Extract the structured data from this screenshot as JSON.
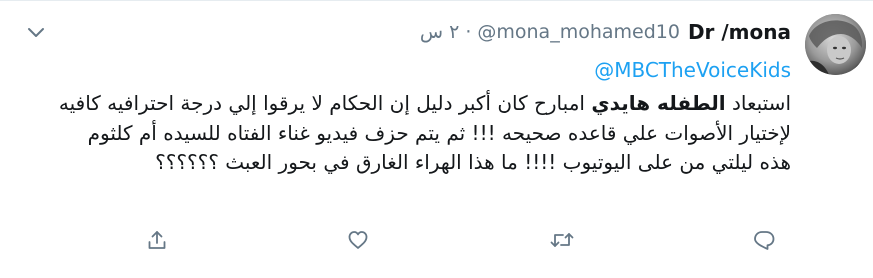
{
  "tweet": {
    "display_name": "Dr /mona",
    "handle": "@mona_mohamed10",
    "separator": "·",
    "time": "٢ س",
    "mention": "@MBCTheVoiceKids",
    "body_lead": "استبعاد ",
    "body_highlight": "الطفله هايدي",
    "body_rest": " امبارح كان أكبر دليل إن الحكام لا يرقوا إلي درجة احترافيه كافيه لإختيار الأصوات علي قاعده صحيحه !!! ثم يتم حزف فيديو غناء الفتاه للسيده أم كلثوم هذه ليلتي من على اليوتيوب !!!! ما هذا الهراء الغارق في بحور العبث ؟؟؟؟؟؟"
  },
  "icons": {
    "menu": "chevron-down-icon",
    "reply": "reply-icon",
    "retweet": "retweet-icon",
    "like": "heart-icon",
    "share": "share-icon"
  },
  "colors": {
    "text": "#14171a",
    "secondary": "#657786",
    "link": "#1da1f2",
    "border": "#e6ecf0"
  }
}
